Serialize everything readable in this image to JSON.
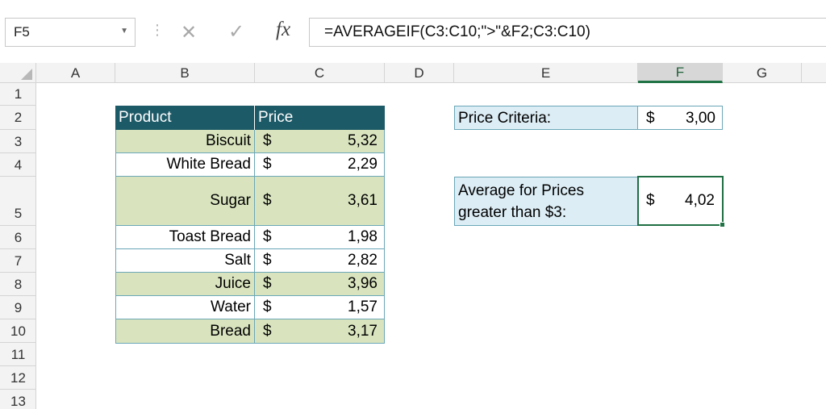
{
  "formula_bar": {
    "name_box": "F5",
    "dropdown_icon": "caret-down",
    "cancel_icon": "x-mark",
    "enter_icon": "check-mark",
    "function_icon": "fx",
    "formula": "=AVERAGEIF(C3:C10;\">\"&F2;C3:C10)"
  },
  "columns": [
    "A",
    "B",
    "C",
    "D",
    "E",
    "F",
    "G"
  ],
  "selected_column": "F",
  "rows": [
    "1",
    "2",
    "3",
    "4",
    "5",
    "6",
    "7",
    "8",
    "9",
    "10",
    "11",
    "12",
    "13"
  ],
  "table": {
    "header": {
      "product": "Product",
      "price": "Price"
    },
    "items": [
      {
        "product": "Biscuit",
        "currency": "$",
        "price": "5,32"
      },
      {
        "product": "White Bread",
        "currency": "$",
        "price": "2,29"
      },
      {
        "product": "Sugar",
        "currency": "$",
        "price": "3,61"
      },
      {
        "product": "Toast Bread",
        "currency": "$",
        "price": "1,98"
      },
      {
        "product": "Salt",
        "currency": "$",
        "price": "2,82"
      },
      {
        "product": "Juice",
        "currency": "$",
        "price": "3,96"
      },
      {
        "product": "Water",
        "currency": "$",
        "price": "1,57"
      },
      {
        "product": "Bread",
        "currency": "$",
        "price": "3,17"
      }
    ]
  },
  "criteria": {
    "label": "Price Criteria:",
    "currency": "$",
    "value": "3,00"
  },
  "result": {
    "label_line1": "Average for Prices",
    "label_line2": "greater than $3:",
    "currency": "$",
    "value": "4,02"
  },
  "colors": {
    "header_fill": "#1d5a67",
    "band_fill": "#d9e4bf",
    "label_fill": "#dcedf5",
    "selection": "#217346"
  }
}
